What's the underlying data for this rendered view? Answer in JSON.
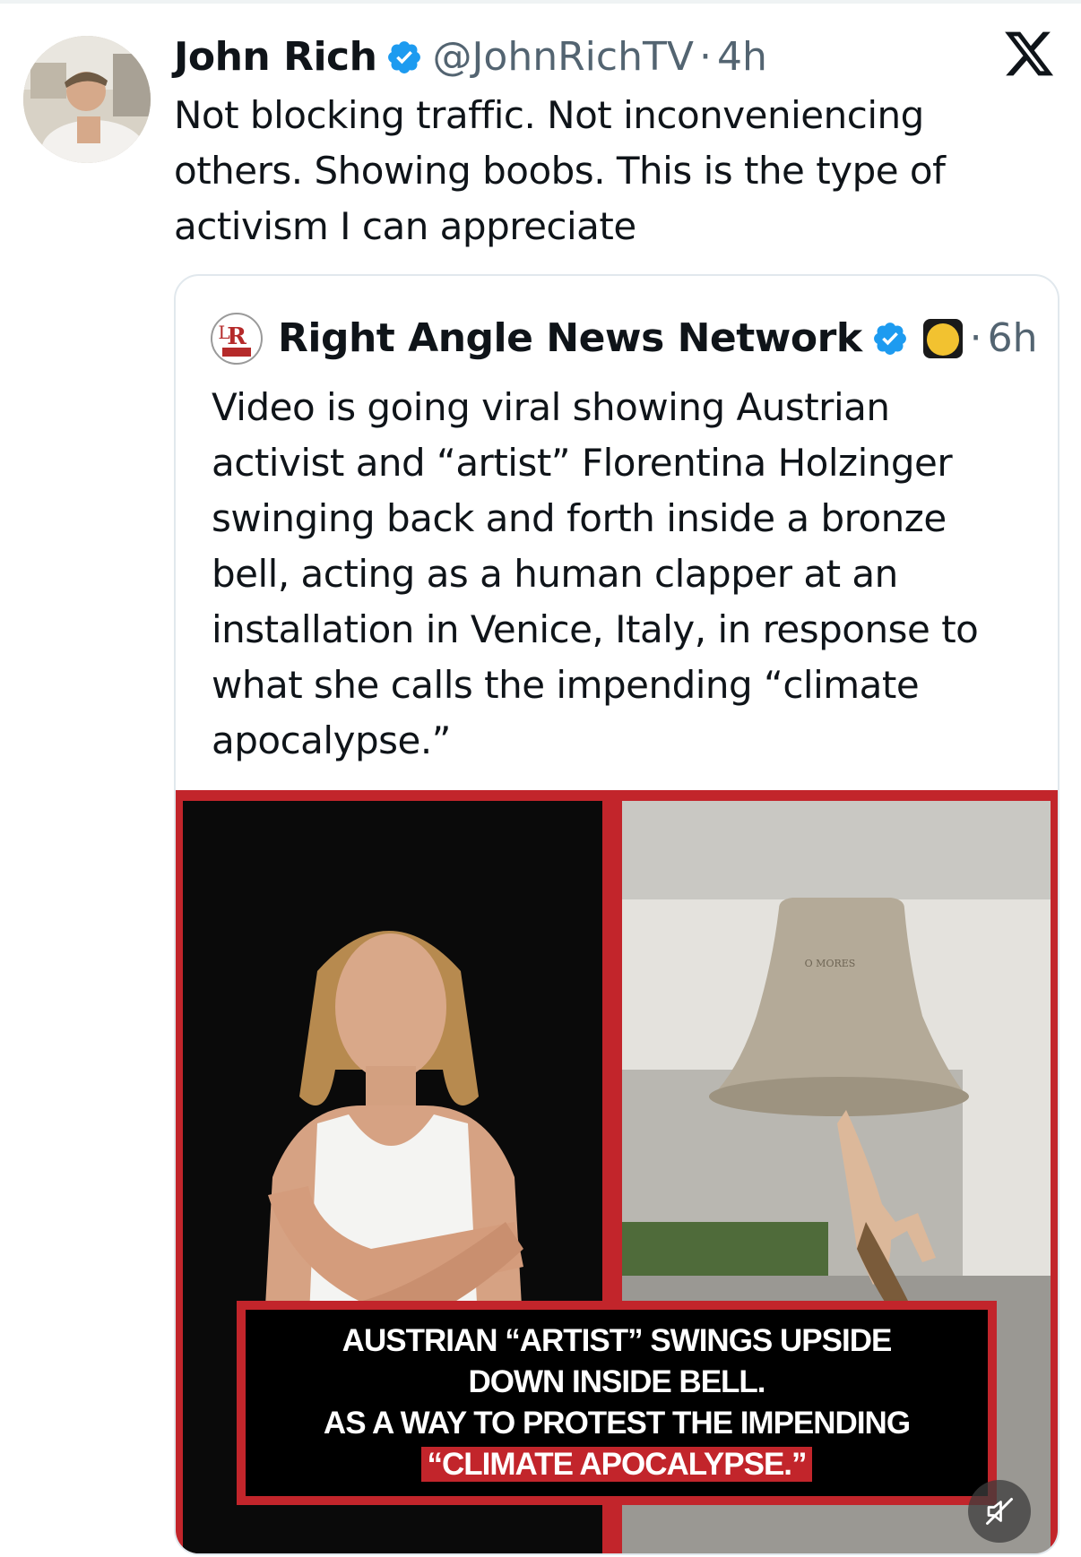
{
  "tweet": {
    "author_name": "John Rich",
    "handle": "@JohnRichTV",
    "separator": "·",
    "timestamp": "4h",
    "text_lines": [
      "Not blocking traffic. Not inconveniencing",
      "others. Showing boobs. This is the type of",
      "activism I can appreciate"
    ],
    "avatar_icon": "profile-photo",
    "platform_icon": "x-logo-icon"
  },
  "quoted_tweet": {
    "author_name": "Right Angle News Network",
    "separator": "·",
    "timestamp": "6h",
    "text_lines": [
      "Video is going viral showing Austrian",
      "activist and “artist” Florentina Holzinger",
      "swinging back and forth inside a bronze",
      "bell, acting as a human clapper at an",
      "installation in Venice, Italy, in response to",
      "what she calls the impending “climate",
      "apocalypse.”"
    ],
    "media": {
      "caption_lines": [
        "AUSTRIAN “ARTIST” SWINGS UPSIDE",
        "DOWN INSIDE BELL.",
        "AS A WAY TO PROTEST THE IMPENDING"
      ],
      "caption_highlight": "“CLIMATE APOCALYPSE.”",
      "bell_inscription": "O MORES"
    }
  },
  "colors": {
    "text": "#0f1419",
    "secondary": "#536471",
    "verified": "#1d9bf0",
    "accent_red": "#c2252b",
    "border": "#e1e8ed"
  }
}
